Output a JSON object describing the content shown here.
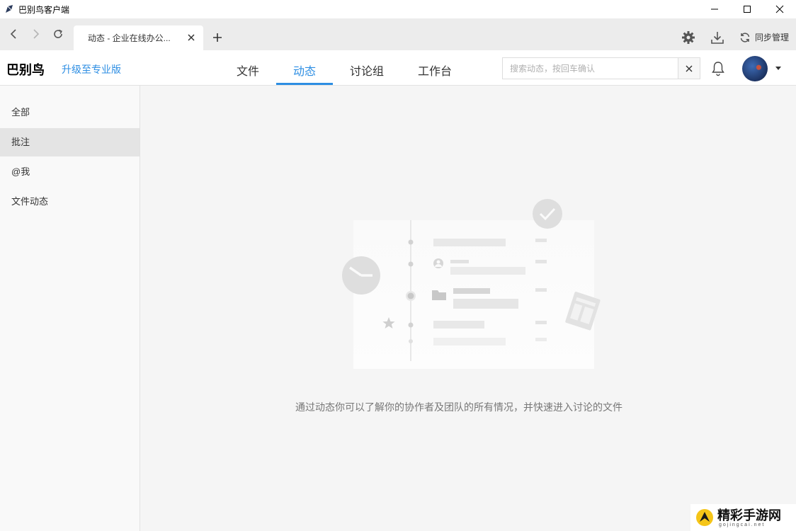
{
  "window": {
    "title": "巴别鸟客户端"
  },
  "tabbar": {
    "tab_title": "动态 - 企业在线办公...",
    "sync_label": "同步管理"
  },
  "header": {
    "brand": "巴别鸟",
    "upgrade": "升级至专业版",
    "nav": [
      {
        "label": "文件",
        "active": false
      },
      {
        "label": "动态",
        "active": true
      },
      {
        "label": "讨论组",
        "active": false
      },
      {
        "label": "工作台",
        "active": false
      }
    ],
    "search": {
      "placeholder": "搜索动态，按回车确认",
      "value": ""
    }
  },
  "sidebar": {
    "items": [
      {
        "label": "全部",
        "active": false
      },
      {
        "label": "批注",
        "active": true
      },
      {
        "label": "@我",
        "active": false
      },
      {
        "label": "文件动态",
        "active": false
      }
    ]
  },
  "main": {
    "empty_text": "通过动态你可以了解你的协作者及团队的所有情况，并快速进入讨论的文件"
  },
  "watermark": {
    "text": "精彩手游网",
    "sub": "gojingcai.net"
  },
  "colors": {
    "accent": "#2d8ee3",
    "sidebar_active": "#e4e4e4",
    "background": "#f5f5f5"
  },
  "icons": {
    "back": "chevron-left-icon",
    "forward": "chevron-right-icon",
    "refresh": "refresh-icon",
    "settings": "gear-icon",
    "download": "download-icon",
    "sync": "sync-icon",
    "notifications": "bell-icon",
    "clear": "close-icon"
  }
}
